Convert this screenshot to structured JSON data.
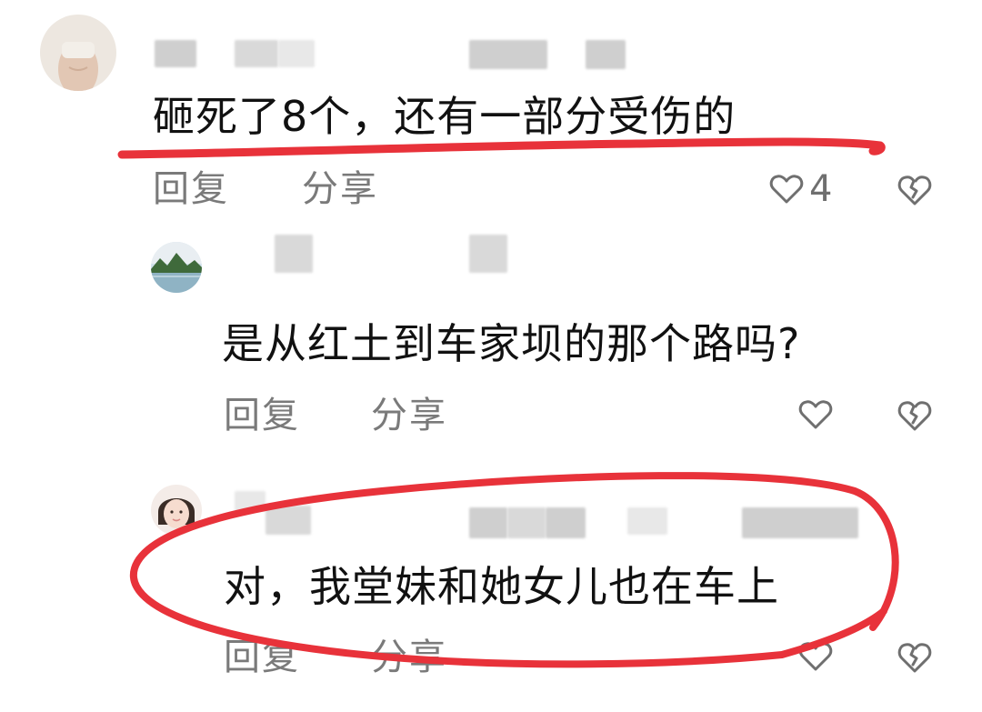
{
  "comments": [
    {
      "text": "砸死了8个，还有一部分受伤的",
      "reply_label": "回复",
      "share_label": "分享",
      "like_count": "4",
      "like_icon": "heart-outline-icon",
      "dislike_icon": "broken-heart-icon"
    },
    {
      "text": "是从红土到车家坝的那个路吗?",
      "reply_label": "回复",
      "share_label": "分享",
      "like_icon": "heart-outline-icon",
      "dislike_icon": "broken-heart-icon"
    },
    {
      "text": "对，我堂妹和她女儿也在车上",
      "reply_label": "回复",
      "share_label": "分享",
      "like_icon": "heart-outline-icon",
      "dislike_icon": "broken-heart-icon"
    }
  ],
  "colors": {
    "text": "#111111",
    "secondary_text": "#7a7a7a",
    "annotation_red": "#e8323a",
    "blur_gray": "#d9d9d9"
  }
}
